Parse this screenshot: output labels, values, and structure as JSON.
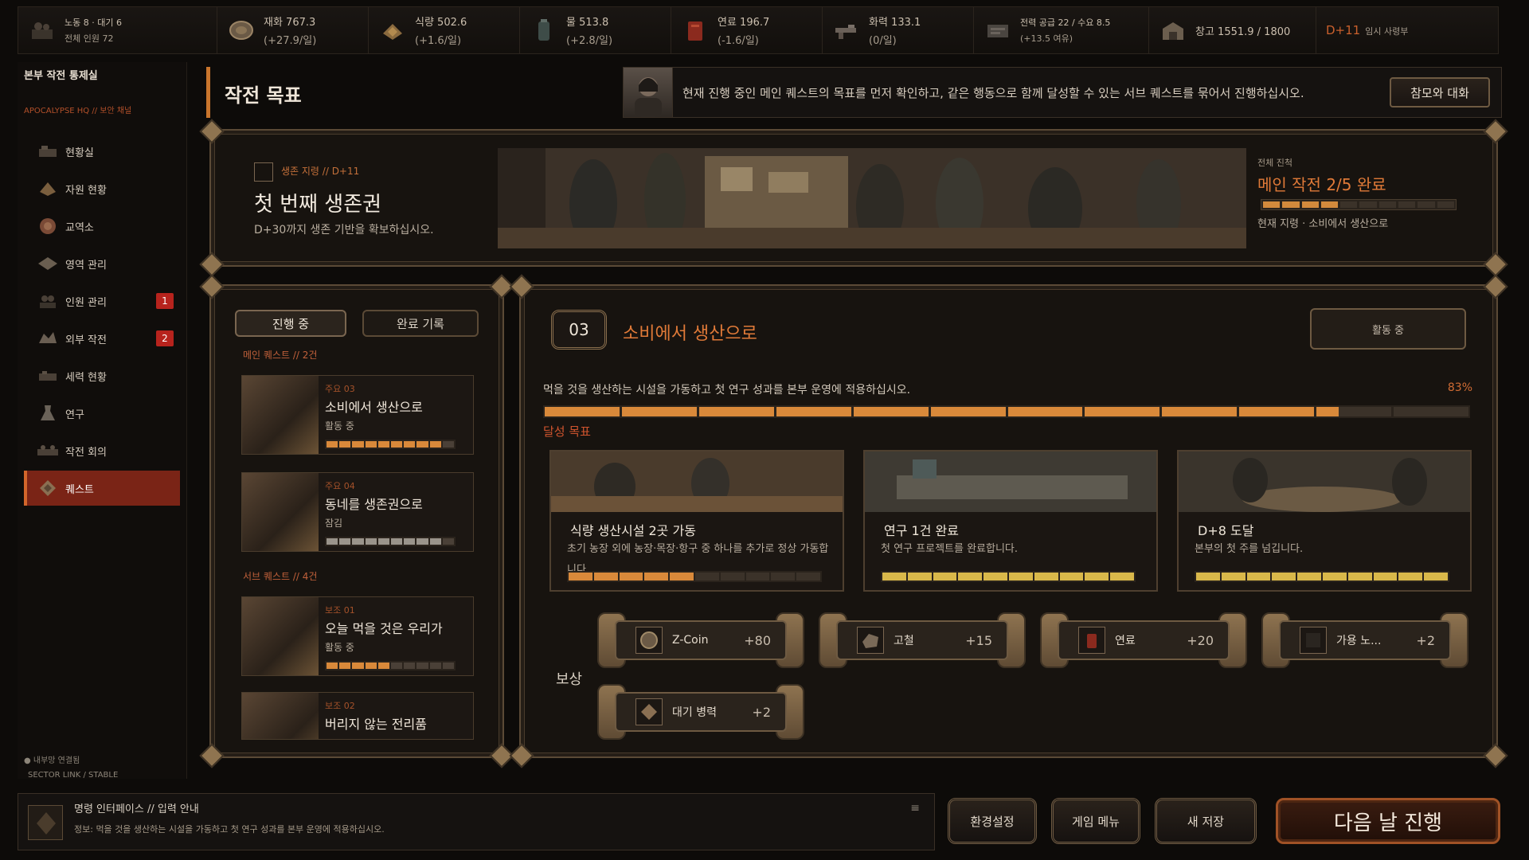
{
  "topbar": {
    "resources": [
      {
        "icon": "people-icon",
        "line1": "노동 8 · 대기 6",
        "line2": "전체 인원 72"
      },
      {
        "icon": "coin-icon",
        "line1": "재화 767.3",
        "line2": "(+27.9/일)"
      },
      {
        "icon": "food-icon",
        "line1": "식량 502.6",
        "line2": "(+1.6/일)"
      },
      {
        "icon": "water-icon",
        "line1": "물 513.8",
        "line2": "(+2.8/일)"
      },
      {
        "icon": "fuel-icon",
        "line1": "연료 196.7",
        "line2": "(-1.6/일)"
      },
      {
        "icon": "firepower-icon",
        "line1": "화력 133.1",
        "line2": "(0/일)"
      },
      {
        "icon": "power-icon",
        "line1": "전력 공급 22 / 수요 8.5",
        "line2": "(+13.5 여유)"
      },
      {
        "icon": "warehouse-icon",
        "line1": "창고 1551.9 / 1800",
        "line2": ""
      }
    ],
    "day": "D+11",
    "day_sub": "임시 사령부"
  },
  "sidebar": {
    "title": "본부 작전 통제실",
    "subtitle": "APOCALYPSE HQ // 보안 채널",
    "items": [
      {
        "label": "현황실",
        "icon": "overview-icon",
        "badge": ""
      },
      {
        "label": "자원 현황",
        "icon": "resources-icon",
        "badge": ""
      },
      {
        "label": "교역소",
        "icon": "trade-icon",
        "badge": ""
      },
      {
        "label": "영역 관리",
        "icon": "territory-icon",
        "badge": ""
      },
      {
        "label": "인원 관리",
        "icon": "personnel-icon",
        "badge": "1"
      },
      {
        "label": "외부 작전",
        "icon": "expedition-icon",
        "badge": "2"
      },
      {
        "label": "세력 현황",
        "icon": "faction-icon",
        "badge": ""
      },
      {
        "label": "연구",
        "icon": "research-icon",
        "badge": ""
      },
      {
        "label": "작전 회의",
        "icon": "meeting-icon",
        "badge": ""
      },
      {
        "label": "퀘스트",
        "icon": "quest-icon",
        "badge": ""
      }
    ],
    "active_index": 9,
    "status_line1": "● 내부망 연결됨",
    "status_line2": "SECTOR LINK / STABLE"
  },
  "header": {
    "title": "작전 목표",
    "advisor_message": "현재 진행 중인 메인 퀘스트의 목표를 먼저 확인하고, 같은 행동으로 함께 달성할 수 있는 서브 퀘스트를 묶어서 진행하십시오.",
    "advisor_button": "참모와 대화"
  },
  "banner": {
    "tag": "생존 지령 // D+11",
    "title": "첫 번째 생존권",
    "desc": "D+30까지 생존 기반을 확보하십시오.",
    "right_label": "전체 진척",
    "right_title": "메인 작전 2/5 완료",
    "right_progress": 0.4,
    "right_sub": "현재 지령 · 소비에서 생산으로"
  },
  "questlist": {
    "tab_active": "진행 중",
    "tab_done": "완료 기록",
    "main_header": "메인 퀘스트 // 2건",
    "sub_header": "서브 퀘스트 // 4건",
    "main": [
      {
        "code": "주요 03",
        "name": "소비에서 생산으로",
        "status": "활동 중",
        "progress": 0.83
      },
      {
        "code": "주요 04",
        "name": "동네를 생존권으로",
        "status": "잠김",
        "progress": 0.9
      }
    ],
    "sub": [
      {
        "code": "보조 01",
        "name": "오늘 먹을 것은 우리가",
        "status": "활동 중",
        "progress": 0.5
      },
      {
        "code": "보조 02",
        "name": "버리지 않는 전리품",
        "status": "",
        "progress": 0
      }
    ]
  },
  "detail": {
    "number": "03",
    "title": "소비에서 생산으로",
    "status": "활동 중",
    "description": "먹을 것을 생산하는 시설을 가동하고 첫 연구 성과를 본부 운영에 적용하십시오.",
    "percent": "83%",
    "progress": 0.83,
    "goals_header": "달성 목표",
    "goals": [
      {
        "title": "식량 생산시설 2곳 가동",
        "desc": "초기 농장 외에 농장·목장·항구 중 하나를 추가로 정상 가동합니다.",
        "progress": 0.5
      },
      {
        "title": "연구 1건 완료",
        "desc": "첫 연구 프로젝트를 완료합니다.",
        "progress": 1.0
      },
      {
        "title": "D+8 도달",
        "desc": "본부의 첫 주를 넘깁니다.",
        "progress": 1.0
      }
    ],
    "rewards_label": "보상",
    "rewards": [
      {
        "icon": "zcoin-icon",
        "name": "Z-Coin",
        "value": "+80"
      },
      {
        "icon": "scrap-icon",
        "name": "고철",
        "value": "+15"
      },
      {
        "icon": "fuel-can-icon",
        "name": "연료",
        "value": "+20"
      },
      {
        "icon": "worker-icon",
        "name": "가용 노...",
        "value": "+2"
      },
      {
        "icon": "reserve-icon",
        "name": "대기 병력",
        "value": "+2"
      }
    ]
  },
  "bottom": {
    "cmd_title": "명령 인터페이스 // 입력 안내",
    "cmd_info": "정보: 먹을 것을 생산하는 시설을 가동하고 첫 연구 성과를 본부 운영에 적용하십시오.",
    "menu_icon": "≡",
    "settings": "환경설정",
    "game_menu": "게임 메뉴",
    "save": "새 저장",
    "next_day": "다음 날 진행"
  }
}
